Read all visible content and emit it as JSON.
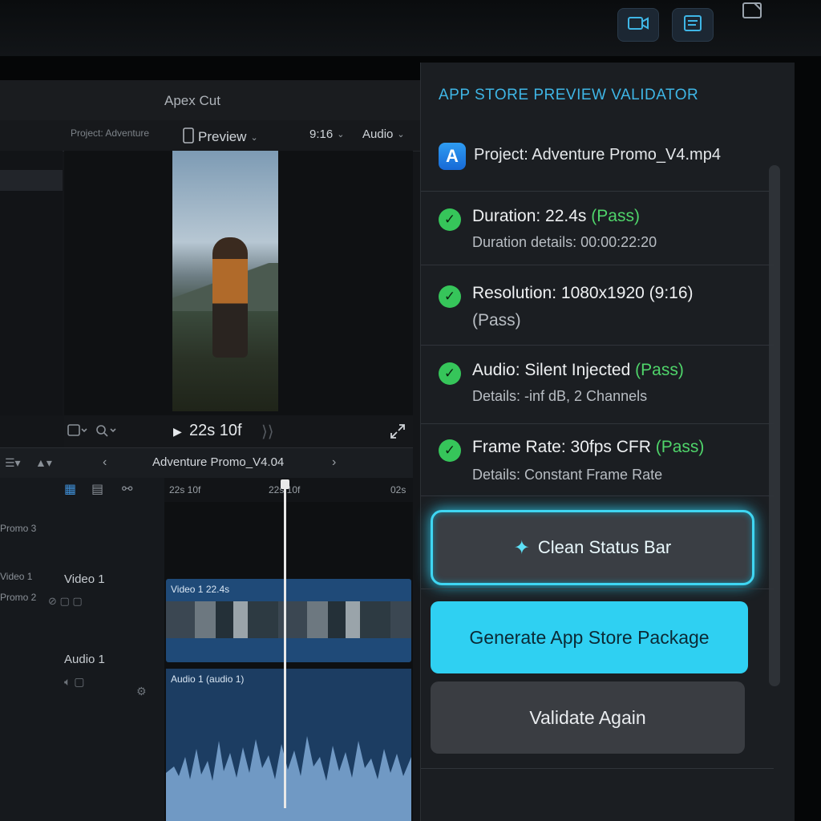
{
  "editor": {
    "app_title": "Apex Cut",
    "project_crumb": "Project: Adventure",
    "preview_label": "Preview",
    "aspect_label": "9:16",
    "audio_label": "Audio",
    "timecode": "22s 10f",
    "sequence_title": "Adventure Promo_V4.04",
    "ruler_labels": [
      "22s 10f",
      "22s 10f",
      "02s"
    ],
    "tracks": {
      "video_track_name": "Video 1",
      "audio_track_name": "Audio 1",
      "video_clip_label": "Video 1 22.4s",
      "audio_clip_label": "Audio 1 (audio 1)",
      "side_labels": [
        "Promo 3",
        "Video 1",
        "Promo 2"
      ]
    }
  },
  "validator": {
    "title": "APP STORE PREVIEW VALIDATOR",
    "project": "Project: Adventure Promo_V4.mp4",
    "checks": [
      {
        "label": "Duration: 22.4s",
        "status": "(Pass)",
        "detail": "Duration details: 00:00:22:20"
      },
      {
        "label": "Resolution: 1080x1920 (9:16)",
        "status": "(Pass)",
        "detail": ""
      },
      {
        "label": "Audio: Silent Injected",
        "status": "(Pass)",
        "detail": "Details: -inf dB, 2 Channels"
      },
      {
        "label": "Frame Rate: 30fps CFR",
        "status": "(Pass)",
        "detail": "Details: Constant Frame Rate"
      }
    ],
    "clean_button": "Clean Status Bar",
    "generate_button": "Generate App Store Package",
    "validate_button": "Validate Again"
  },
  "colors": {
    "accent": "#3fd6f2",
    "pass": "#4fd46a",
    "title_blue": "#3fb6e6"
  },
  "icons": [
    "video-camera-icon",
    "notes-icon",
    "window-icon",
    "app-store-icon",
    "check-circle-icon",
    "sparkle-icon",
    "play-icon",
    "expand-icon",
    "chevron-down-icon",
    "chevron-left-icon",
    "chevron-right-icon"
  ]
}
